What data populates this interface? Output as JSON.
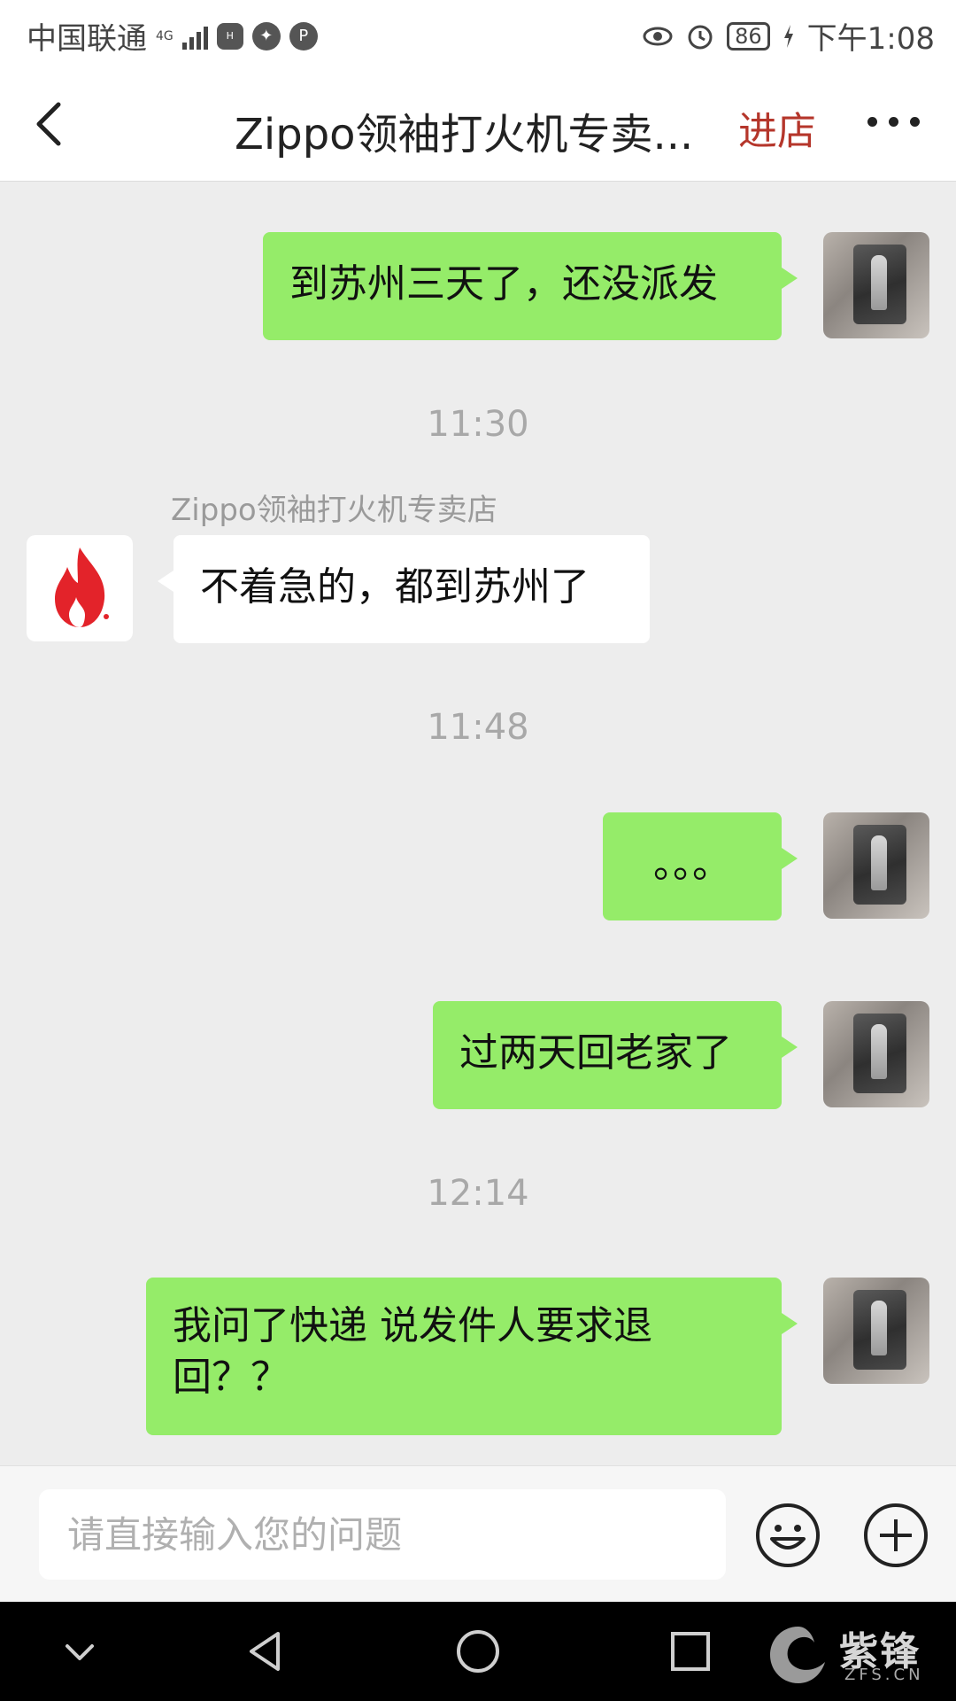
{
  "status_bar": {
    "carrier": "中国联通",
    "network": "4G",
    "battery": "86",
    "time": "下午1:08"
  },
  "header": {
    "title": "Zippo领袖打火机专卖...",
    "enter_store": "进店"
  },
  "messages": {
    "m1": {
      "text": "到苏州三天了，还没派发"
    },
    "t1": "11:30",
    "shop_name": "Zippo领袖打火机专卖店",
    "m2": {
      "text": "不着急的，都到苏州了"
    },
    "t2": "11:48",
    "m3": {
      "text": "。。。"
    },
    "m4": {
      "text": "过两天回老家了"
    },
    "t3": "12:14",
    "m5": {
      "text": "我问了快递  说发件人要求退回？？"
    }
  },
  "input": {
    "placeholder": "请直接输入您的问题"
  },
  "watermark": {
    "text": "紫锋",
    "sub": "ZFS.CN"
  },
  "colors": {
    "outgoing_bubble": "#95ec69",
    "incoming_bubble": "#ffffff",
    "enter_store": "#b5362b",
    "chat_bg": "#ededed",
    "flame": "#e3232a"
  },
  "icons": [
    "back-arrow-icon",
    "more-dots-icon",
    "emoji-icon",
    "plus-icon",
    "eye-icon",
    "alarm-icon",
    "flame-logo-icon"
  ]
}
